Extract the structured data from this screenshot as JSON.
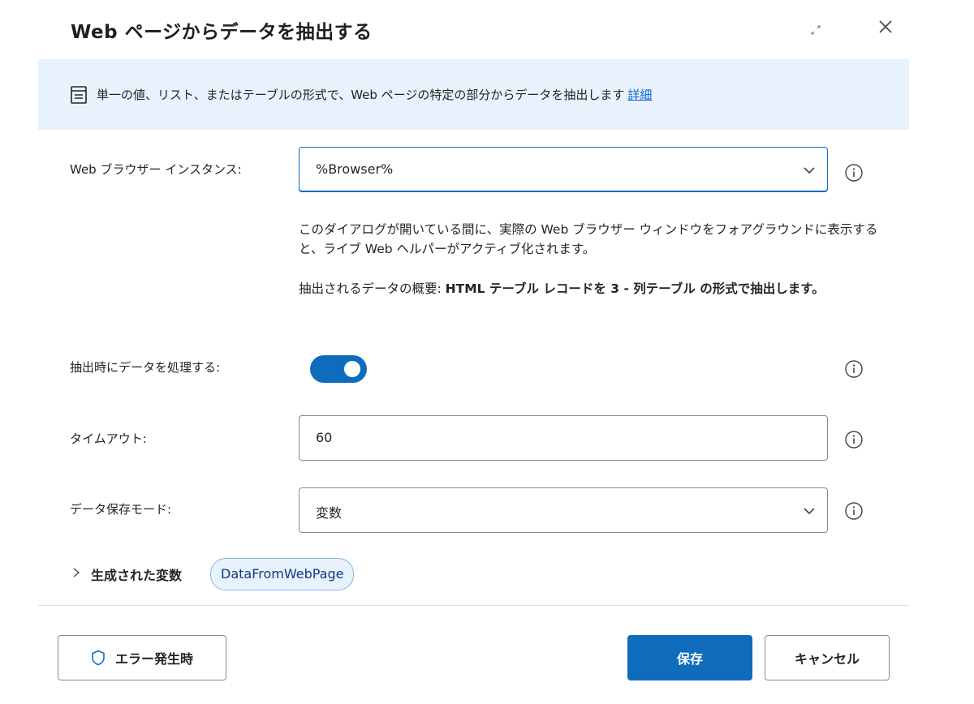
{
  "dialog": {
    "title": "Web ページからデータを抽出する"
  },
  "banner": {
    "text": "単一の値、リスト、またはテーブルの形式で、Web ページの特定の部分からデータを抽出します",
    "link": "詳細"
  },
  "fields": {
    "browser": {
      "label": "Web ブラウザー インスタンス:",
      "value": "%Browser%"
    },
    "process": {
      "label": "抽出時にデータを処理する:",
      "enabled": true
    },
    "timeout": {
      "label": "タイムアウト:",
      "value": "60"
    },
    "storage": {
      "label": "データ保存モード:",
      "value": "変数"
    }
  },
  "help": {
    "live_helper": "このダイアログが開いている間に、実際の Web ブラウザー ウィンドウをフォアグラウンドに表示すると、ライブ Web ヘルパーがアクティブ化されます。",
    "summary_prefix": "抽出されるデータの概要: ",
    "summary_bold": "HTML テーブル レコードを 3 - 列テーブル の形式で抽出します。"
  },
  "generated": {
    "label": "生成された変数",
    "variable": "DataFromWebPage"
  },
  "footer": {
    "error_button": "エラー発生時",
    "save_button": "保存",
    "cancel_button": "キャンセル"
  },
  "colors": {
    "accent": "#0f6cbd",
    "banner_bg": "#e8f2fd",
    "link": "#0f62d0"
  }
}
